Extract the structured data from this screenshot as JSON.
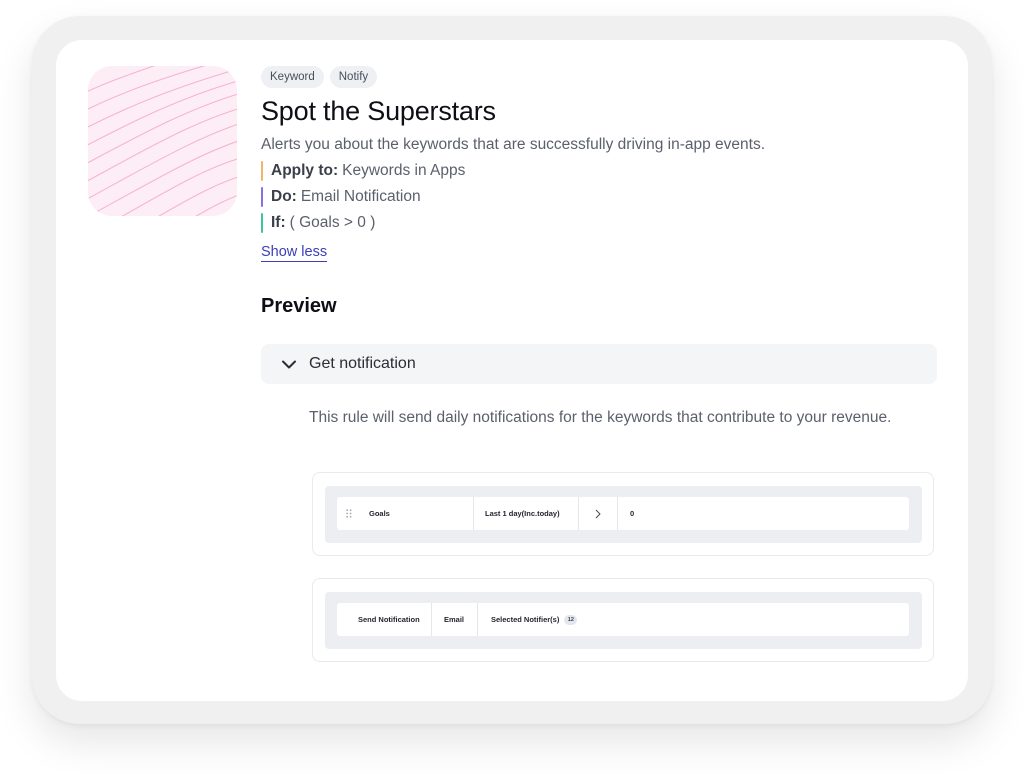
{
  "tags": [
    "Keyword",
    "Notify"
  ],
  "title": "Spot the Superstars",
  "description": "Alerts you about the keywords that are successfully driving in-app events.",
  "properties": [
    {
      "key": "Apply to:",
      "value": "Keywords in Apps",
      "color": "#f0b56a"
    },
    {
      "key": "Do:",
      "value": "Email Notification",
      "color": "#8b6fe0"
    },
    {
      "key": "If:",
      "value": "( Goals > 0 )",
      "color": "#3cc79a"
    }
  ],
  "show_less": "Show less",
  "preview": {
    "heading": "Preview",
    "accordion_label": "Get notification",
    "rule_description": "This rule will send daily notifications for the keywords that contribute to your revenue."
  },
  "condition_card": {
    "metric": "Goals",
    "period": "Last 1 day(Inc.today)",
    "operator_icon": "chevron-right-icon",
    "value": "0"
  },
  "action_card": {
    "action": "Send Notification",
    "channel": "Email",
    "notifier": "Selected Notifier(s)",
    "notifier_count": "12"
  },
  "colors": {
    "thumbnail_bg": "#fdeef6",
    "thumbnail_lines": "#f6b3d4",
    "link": "#3b3fb8"
  }
}
